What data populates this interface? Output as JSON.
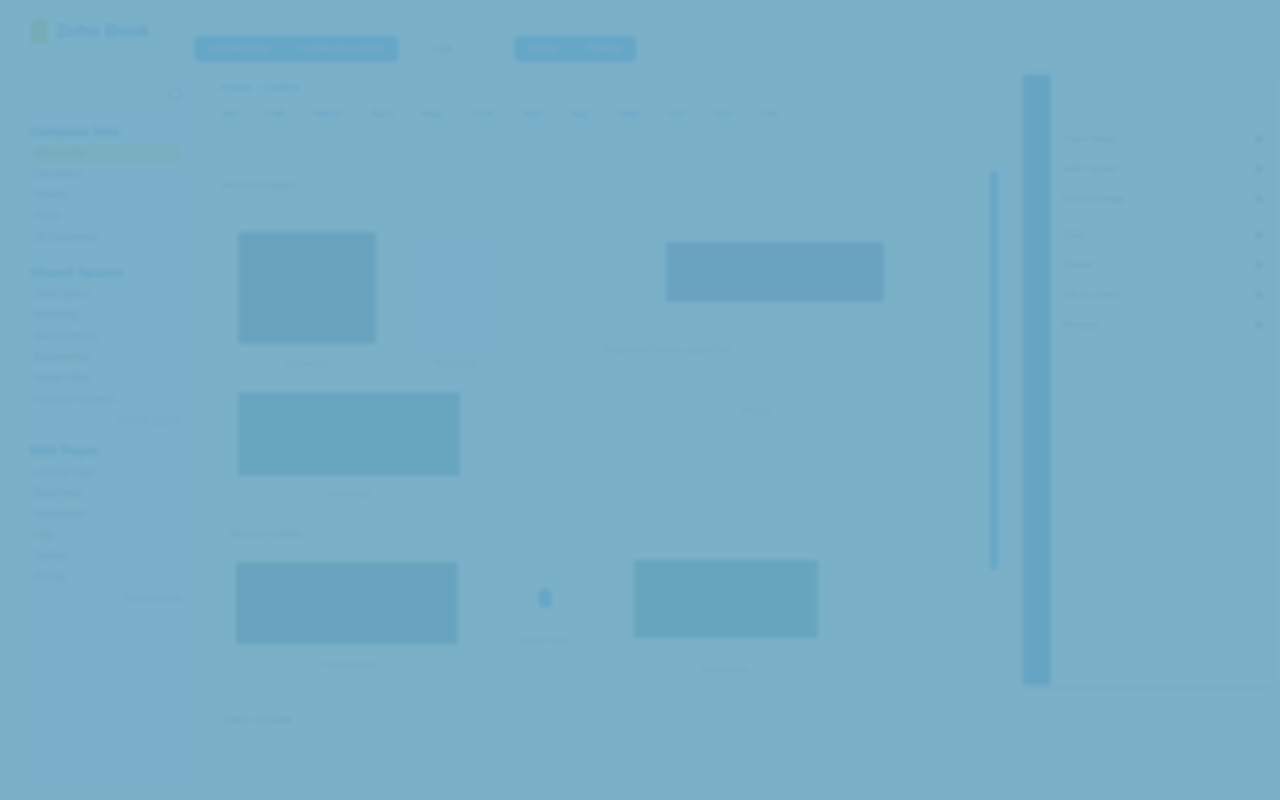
{
  "app": {
    "logo_text": "Zoho Book",
    "colors": {
      "overlay": "#6da7c3",
      "accent": "#2a9be0",
      "brand": "#1e7fbe",
      "highlight": "#f1f3a8"
    }
  },
  "toolbar": {
    "group1": [
      "Upload Files",
      "Create Document"
    ],
    "plain": "Edit",
    "group2": [
      "Share",
      "Publish"
    ]
  },
  "sidebar": {
    "search_placeholder": "",
    "title_main": "Compose New",
    "section1_items": [
      "Documents",
      "Favourites",
      "Shared",
      "Trash",
      "All Documents"
    ],
    "section2_title": "Shared Spaces",
    "section2_items": [
      "Team Space",
      "Marketing",
      "Sales Reports",
      "Engineering",
      "Design Files",
      "Customer Support"
    ],
    "section2_link": "View all spaces",
    "section3_title": "Web Pages",
    "section3_items": [
      "Landing Page",
      "Blog Posts",
      "Newsletters",
      "FAQ",
      "Contact",
      "Pricing"
    ],
    "section3_link": "View all pages"
  },
  "main": {
    "crumbs": "Home › Gallery",
    "months": [
      "Jan",
      "Feb",
      "March",
      "April",
      "May",
      "June",
      "July",
      "Aug",
      "Sept",
      "Oct",
      "Nov",
      "Dec"
    ],
    "section1": "Recent Images",
    "section2": "Shared Images",
    "section3": "Older Uploads",
    "captions": [
      "Skyline.jpg",
      "Report.png",
      "Harbor.jpg",
      "Panorama.jpg",
      "Upload more",
      "Banner.png"
    ],
    "callout_text": "Drag photos here to upload them",
    "callout_button": "Browse"
  },
  "panel": {
    "items": [
      "Insert Image",
      "Add Caption",
      "Resize Image",
      "Crop",
      "Rotate",
      "Set as Cover",
      "Remove"
    ]
  }
}
